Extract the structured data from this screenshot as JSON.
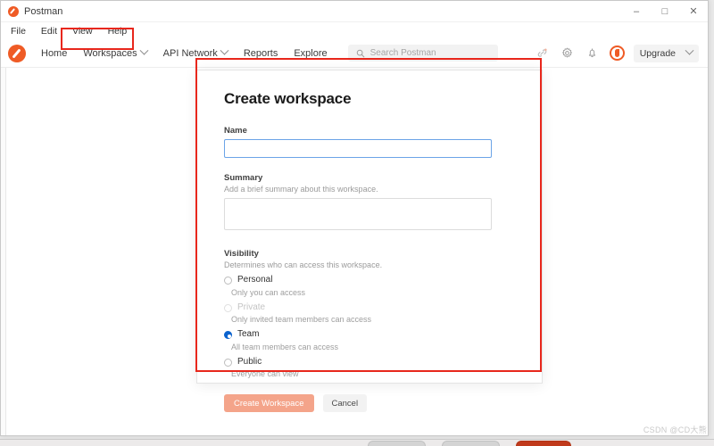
{
  "window": {
    "title": "Postman",
    "logo_icon": "postman-logo-icon",
    "controls": {
      "minimize": "–",
      "maximize": "□",
      "close": "✕"
    }
  },
  "menu_bar": {
    "items": [
      {
        "label": "File"
      },
      {
        "label": "Edit"
      },
      {
        "label": "View"
      },
      {
        "label": "Help"
      }
    ]
  },
  "nav_bar": {
    "logo_icon": "postman-logo-icon",
    "items": [
      {
        "label": "Home",
        "has_caret": false
      },
      {
        "label": "Workspaces",
        "has_caret": true,
        "highlighted": true
      },
      {
        "label": "API Network",
        "has_caret": true
      },
      {
        "label": "Reports",
        "has_caret": false
      },
      {
        "label": "Explore",
        "has_caret": false
      }
    ],
    "search": {
      "icon": "search-icon",
      "placeholder": "Search Postman",
      "value": ""
    },
    "right_icons": [
      {
        "name": "invite-icon"
      },
      {
        "name": "gear-icon"
      },
      {
        "name": "bell-icon"
      },
      {
        "name": "avatar-icon"
      }
    ],
    "upgrade": {
      "label": "Upgrade",
      "caret_icon": "chevron-down-icon"
    }
  },
  "modal": {
    "title": "Create workspace",
    "name": {
      "label": "Name",
      "value": "",
      "placeholder": ""
    },
    "summary": {
      "label": "Summary",
      "hint": "Add a brief summary about this workspace.",
      "value": "",
      "placeholder": ""
    },
    "visibility": {
      "label": "Visibility",
      "hint": "Determines who can access this workspace.",
      "options": [
        {
          "id": "personal",
          "title": "Personal",
          "description": "Only you can access",
          "selected": false,
          "disabled": false
        },
        {
          "id": "private",
          "title": "Private",
          "description": "Only invited team members can access",
          "selected": false,
          "disabled": true
        },
        {
          "id": "team",
          "title": "Team",
          "description": "All team members can access",
          "selected": true,
          "disabled": false
        },
        {
          "id": "public",
          "title": "Public",
          "description": "Everyone can view",
          "selected": false,
          "disabled": false
        }
      ]
    },
    "actions": {
      "primary_label": "Create Workspace",
      "primary_enabled": false,
      "secondary_label": "Cancel"
    }
  },
  "annotations": {
    "color": "#e8271c",
    "boxes": [
      {
        "name": "workspaces-highlight"
      },
      {
        "name": "modal-highlight"
      }
    ]
  },
  "watermark": {
    "text": "CSDN @CD大熊"
  },
  "colors": {
    "brand_orange": "#ef5b25",
    "primary_button": "#f4a48a",
    "radio_selected": "#0b63ce",
    "focus_border": "#6ba4e7",
    "annotation_red": "#e8271c"
  }
}
